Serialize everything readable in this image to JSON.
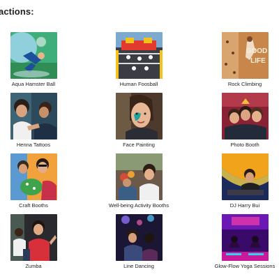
{
  "section": {
    "heading": "actions:"
  },
  "attractions": [
    {
      "label": "Aqua Hamster Ball"
    },
    {
      "label": "Human Foosball"
    },
    {
      "label": "Rock Climbing"
    },
    {
      "label": "Henna Tattoos"
    },
    {
      "label": "Face Painting"
    },
    {
      "label": "Photo Booth"
    },
    {
      "label": "Craft Booths"
    },
    {
      "label": "Well-being Activity Booths"
    },
    {
      "label": "DJ Harry Bui"
    },
    {
      "label": "Zumba"
    },
    {
      "label": "Line Dancing"
    },
    {
      "label": "Glow-Flow Yoga Sessions"
    }
  ]
}
